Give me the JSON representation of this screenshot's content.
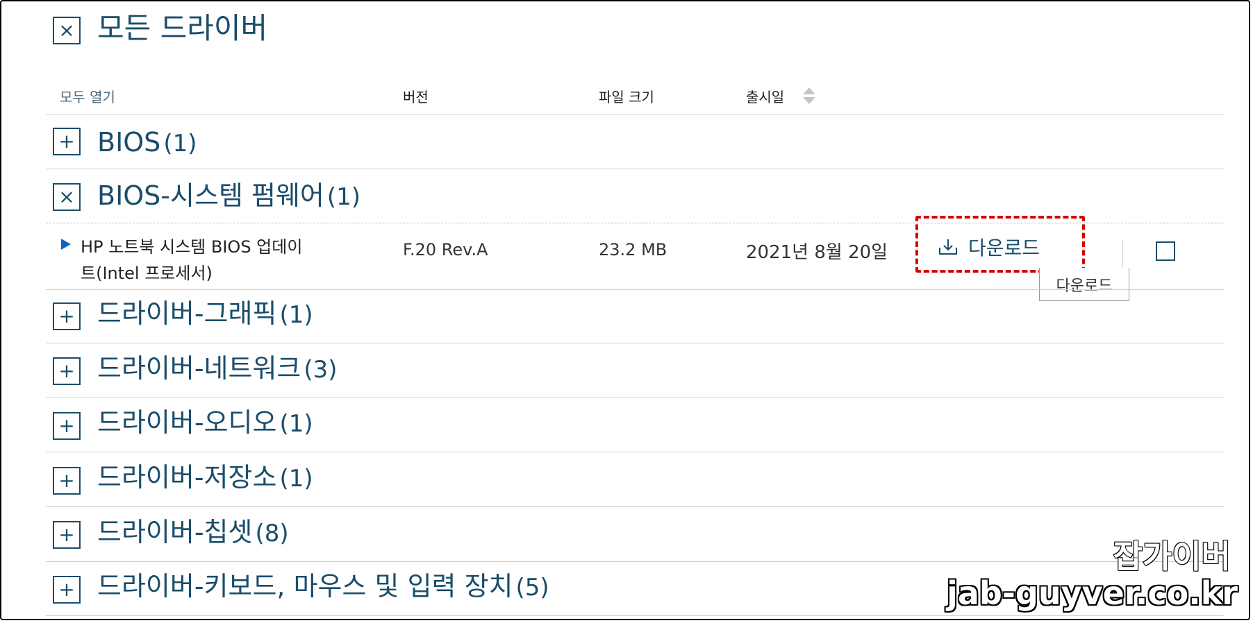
{
  "header": {
    "toggle_symbol": "×",
    "title": "모든 드라이버"
  },
  "columns": {
    "open_all": "모두 열기",
    "version": "버전",
    "file_size": "파일 크기",
    "release_date": "출시일"
  },
  "categories": [
    {
      "symbol": "+",
      "title": "BIOS",
      "count": "(1)"
    },
    {
      "symbol": "×",
      "title": "BIOS-시스템 펌웨어",
      "count": "(1)"
    },
    {
      "symbol": "+",
      "title": "드라이버-그래픽",
      "count": "(1)"
    },
    {
      "symbol": "+",
      "title": "드라이버-네트워크",
      "count": "(3)"
    },
    {
      "symbol": "+",
      "title": "드라이버-오디오",
      "count": "(1)"
    },
    {
      "symbol": "+",
      "title": "드라이버-저장소",
      "count": "(1)"
    },
    {
      "symbol": "+",
      "title": "드라이버-칩셋",
      "count": "(8)"
    },
    {
      "symbol": "+",
      "title": "드라이버-키보드, 마우스 및 입력 장치",
      "count": "(5)"
    }
  ],
  "driver_row": {
    "name_line1": "HP 노트북 시스템 BIOS 업데이",
    "name_line2": "트(Intel 프로세서)",
    "version": "F.20 Rev.A",
    "size": "23.2 MB",
    "date": "2021년 8월 20일",
    "download_label": "다운로드",
    "tooltip": "다운로드"
  },
  "watermark": {
    "korean": "잡가이버",
    "url": "jab-guyver.co.kr"
  },
  "colors": {
    "accent": "#1a4d6b",
    "highlight": "#d50000"
  }
}
